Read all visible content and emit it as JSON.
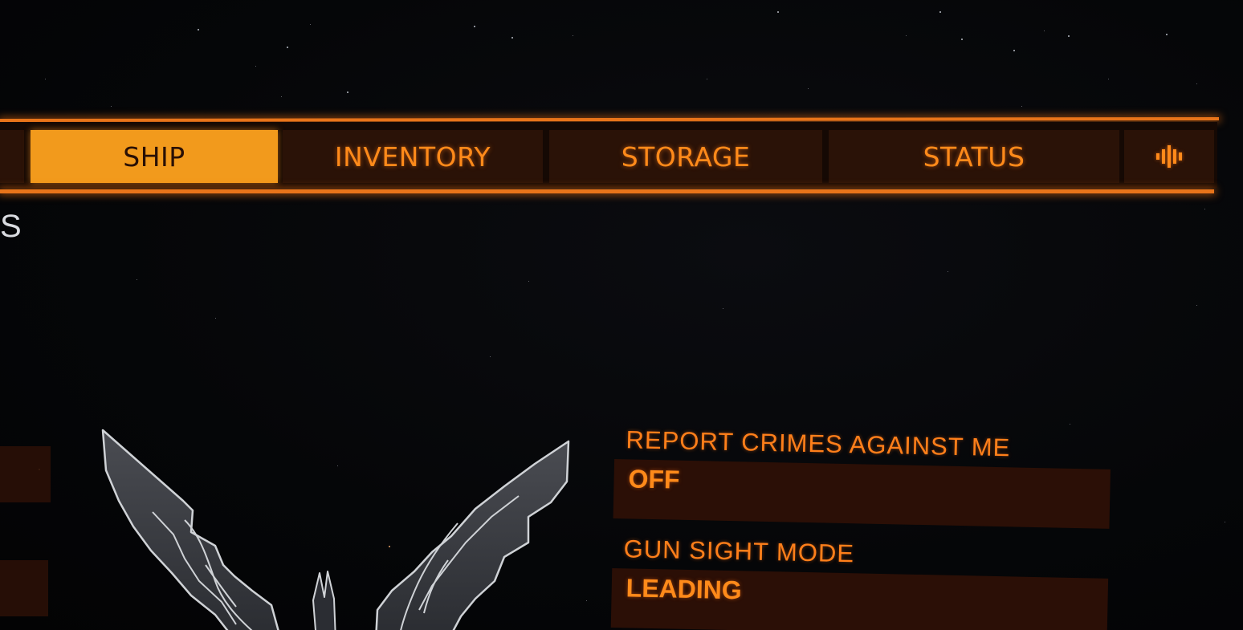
{
  "tabs": [
    {
      "key": "ship",
      "label": "SHIP",
      "active": true
    },
    {
      "key": "inventory",
      "label": "INVENTORY",
      "active": false
    },
    {
      "key": "storage",
      "label": "STORAGE",
      "active": false
    },
    {
      "key": "status",
      "label": "STATUS",
      "active": false
    }
  ],
  "audio_tab_icon": "audio-waveform-icon",
  "left_partial_heading": "S",
  "settings": [
    {
      "label": "REPORT CRIMES AGAINST ME",
      "value": "OFF"
    },
    {
      "label": "GUN SIGHT MODE",
      "value": "LEADING"
    }
  ],
  "emblem_icon": "elite-wings-emblem-icon",
  "colors": {
    "accent_orange": "#ff8a1a",
    "active_tab_fill": "#f29a1c",
    "panel_fill": "#2a1007",
    "background": "#050608"
  }
}
